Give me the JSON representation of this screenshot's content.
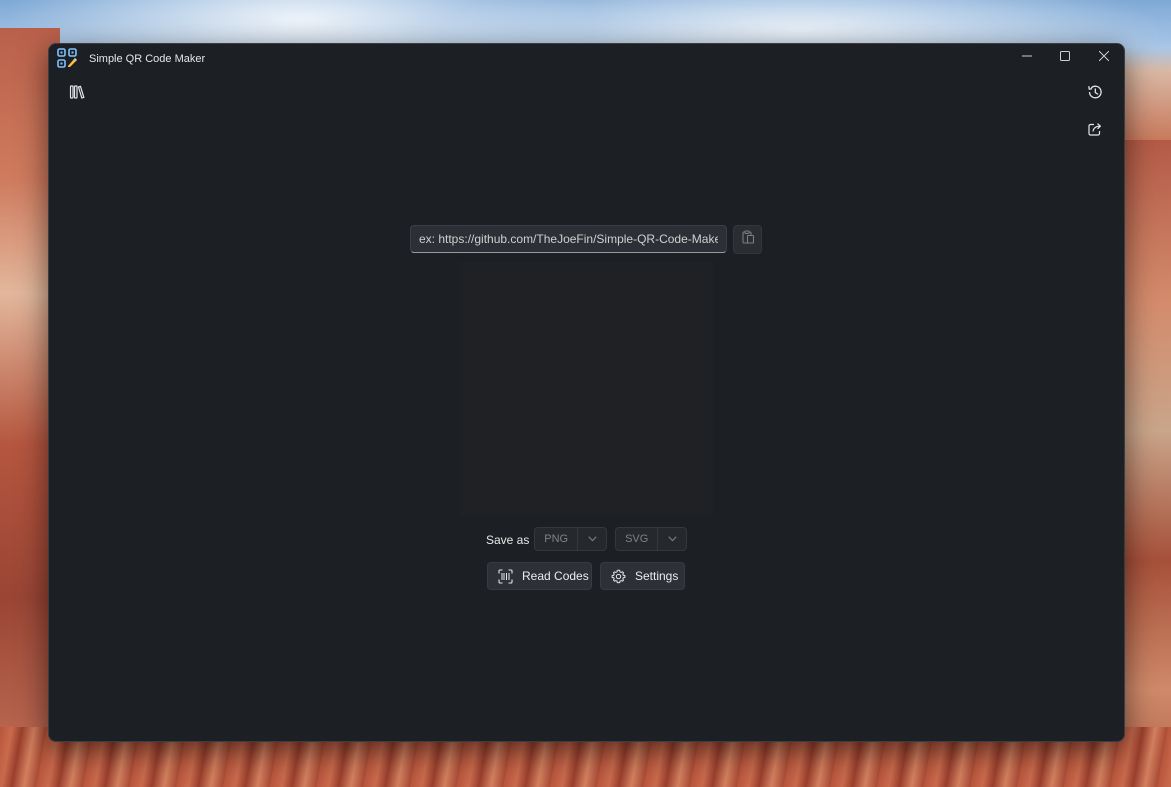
{
  "window": {
    "title": "Simple QR Code Maker",
    "app_icon": "qr-code-pencil-icon"
  },
  "caption_buttons": {
    "minimize": "minimize-icon",
    "maximize": "maximize-icon",
    "close": "close-icon"
  },
  "toolbar": {
    "left_icon": "library-icon",
    "history_icon": "history-icon",
    "share_icon": "share-icon"
  },
  "input": {
    "placeholder": "ex: https://github.com/TheJoeFin/Simple-QR-Code-Maker",
    "value": ""
  },
  "paste_button": {
    "icon": "paste-icon"
  },
  "save": {
    "label": "Save as",
    "png_label": "PNG",
    "svg_label": "SVG"
  },
  "actions": {
    "read_codes_label": "Read Codes",
    "settings_label": "Settings"
  }
}
